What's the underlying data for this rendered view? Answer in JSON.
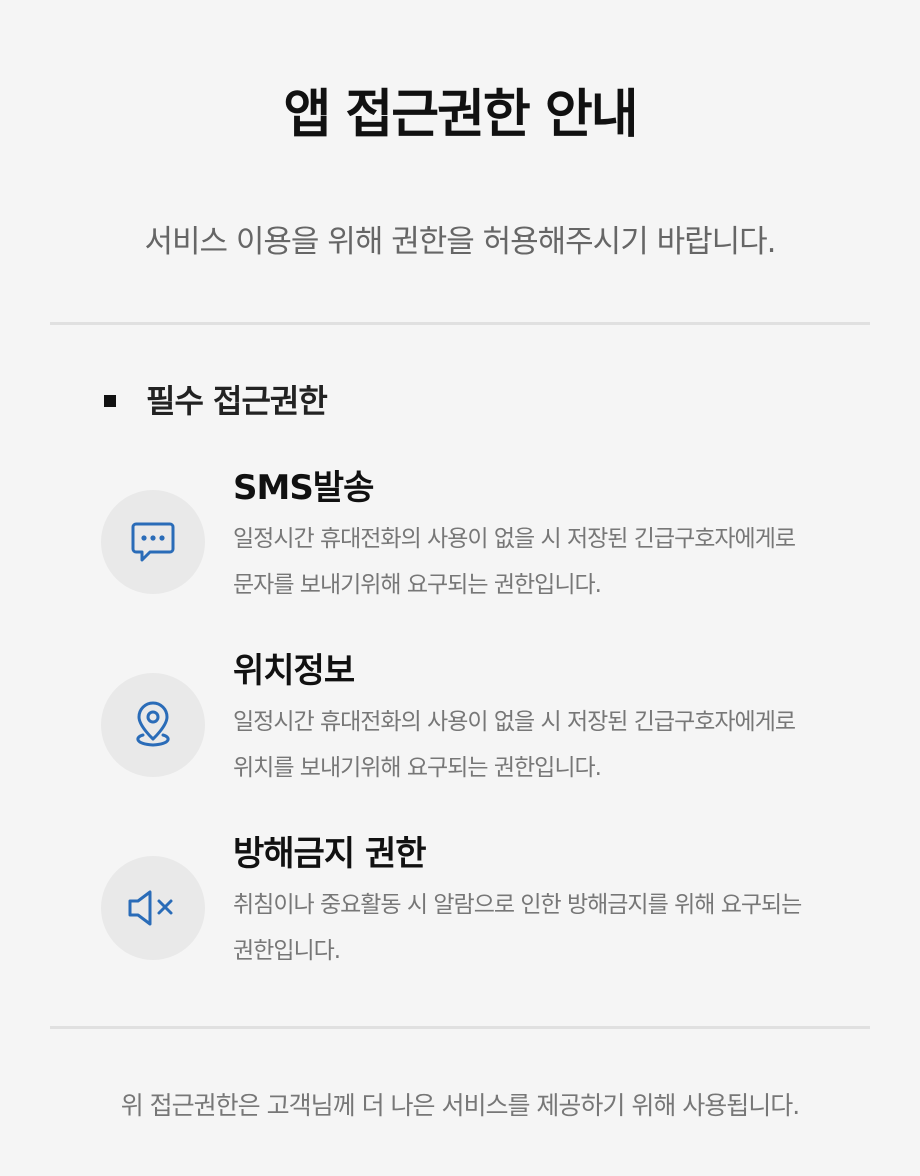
{
  "title": "앱 접근권한 안내",
  "subtitle": "서비스 이용을 위해 권한을 허용해주시기 바랍니다.",
  "section": {
    "title": "필수 접근권한"
  },
  "permissions": [
    {
      "name": "SMS발송",
      "desc_line1": "일정시간 휴대전화의 사용이 없을 시 저장된 긴급구호자에게로",
      "desc_line2": "문자를 보내기위해  요구되는 권한입니다.",
      "icon": "message-icon"
    },
    {
      "name": "위치정보",
      "desc_line1": "일정시간 휴대전화의 사용이 없을 시 저장된 긴급구호자에게로",
      "desc_line2": "위치를 보내기위해  요구되는 권한입니다.",
      "icon": "location-pin-icon"
    },
    {
      "name": "방해금지 권한",
      "desc_line1": "취침이나 중요활동 시 알람으로 인한 방해금지를 위해  요구되는",
      "desc_line2": "권한입니다.",
      "icon": "mute-icon"
    }
  ],
  "footer": "위 접근권한은 고객님께 더 나은 서비스를 제공하기 위해 사용됩니다.",
  "colors": {
    "icon": "#2a6cb8",
    "background": "#f5f5f5",
    "circle": "#e9e9e9"
  }
}
